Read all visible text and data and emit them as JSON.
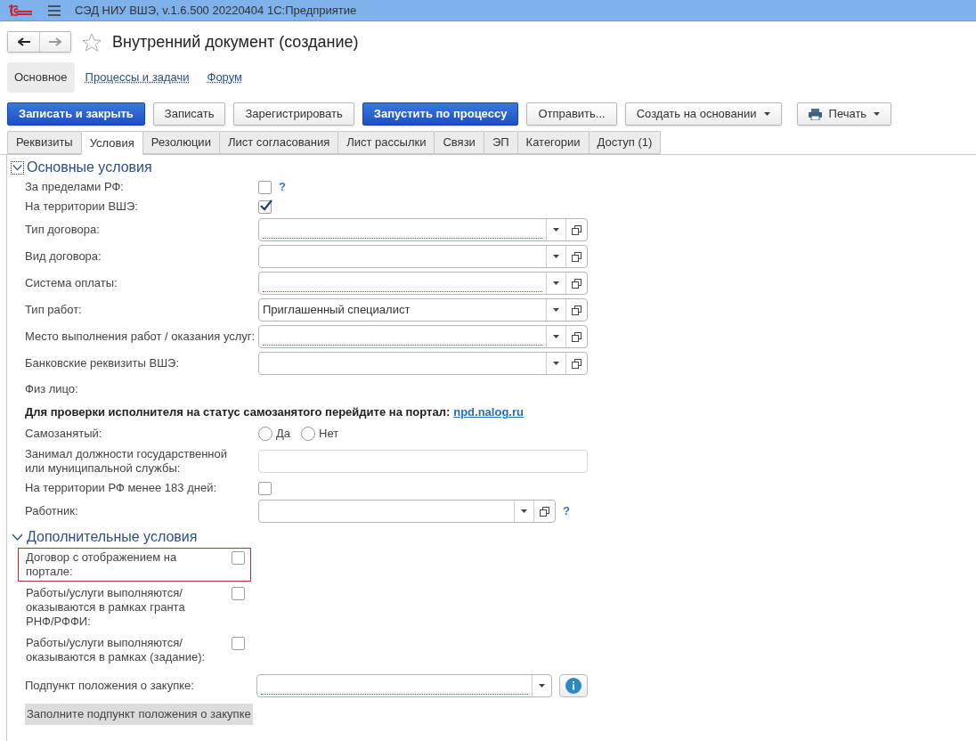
{
  "app_bar": {
    "title": "СЭД НИУ ВШЭ, v.1.6.500 20220404 1С:Предприятие"
  },
  "window": {
    "title": "Внутренний документ (создание)",
    "favorite": false
  },
  "sections": [
    {
      "label": "Основное",
      "selected": true
    },
    {
      "label": "Процессы и задачи",
      "selected": false
    },
    {
      "label": "Форум",
      "selected": false
    }
  ],
  "toolbar": [
    {
      "label": "Записать и закрыть",
      "kind": "primary"
    },
    {
      "label": "Записать",
      "kind": "plain"
    },
    {
      "label": "Зарегистрировать",
      "kind": "plain"
    },
    {
      "label": "Запустить по процессу",
      "kind": "primary"
    },
    {
      "label": "Отправить...",
      "kind": "plain"
    },
    {
      "label": "Создать на основании",
      "kind": "menu"
    },
    {
      "label": "Печать",
      "kind": "print"
    }
  ],
  "tabs": [
    {
      "label": "Реквизиты",
      "selected": false
    },
    {
      "label": "Условия",
      "selected": true
    },
    {
      "label": "Резолюции",
      "selected": false
    },
    {
      "label": "Лист согласования",
      "selected": false
    },
    {
      "label": "Лист рассылки",
      "selected": false
    },
    {
      "label": "Связи",
      "selected": false
    },
    {
      "label": "ЭП",
      "selected": false
    },
    {
      "label": "Категории",
      "selected": false
    },
    {
      "label": "Доступ (1)",
      "selected": false
    }
  ],
  "main_conditions": {
    "title": "Основные условия",
    "expanded": true,
    "fields": [
      {
        "kind": "checkbox",
        "label": "За пределами РФ:",
        "checked": false,
        "help": "?"
      },
      {
        "kind": "checkbox",
        "label": "На территории ВШЭ:",
        "checked": true
      },
      {
        "kind": "select",
        "label": "Тип договора:",
        "required": true
      },
      {
        "kind": "select",
        "label": "Вид договора:",
        "required": false
      },
      {
        "kind": "select",
        "label": "Система оплаты:",
        "required": true
      },
      {
        "kind": "select",
        "label": "Тип работ:",
        "value": "Приглашенный специалист",
        "required": false
      },
      {
        "kind": "select",
        "label": "Место выполнения работ / оказания услуг:",
        "required": true
      },
      {
        "kind": "select",
        "label": "Банковские реквизиты ВШЭ:",
        "required": false
      },
      {
        "kind": "label",
        "label": "Физ лицо:"
      },
      {
        "kind": "notice",
        "text": "Для проверки исполнителя на статус самозанятого перейдите на портал:",
        "link": "npd.nalog.ru"
      },
      {
        "kind": "radio",
        "label": "Самозанятый:",
        "options": [
          {
            "label": "Да",
            "selected": false
          },
          {
            "label": "Нет",
            "selected": false
          }
        ]
      },
      {
        "kind": "text",
        "label": "Занимал должности государственной или муниципальной службы:"
      },
      {
        "kind": "checkbox",
        "label": "На территории РФ менее 183 дней:",
        "checked": false
      },
      {
        "kind": "select",
        "label": "Работник:",
        "required": false,
        "help": "?"
      }
    ]
  },
  "extra_conditions": {
    "title": "Дополнительные условия",
    "expanded": true,
    "fields": [
      {
        "kind": "checkbox",
        "label": "Договор с отображением на портале:",
        "checked": false,
        "highlighted": true
      },
      {
        "kind": "checkbox",
        "label": "Работы/услуги выполняются/оказываются в рамках гранта РНФ/РФФИ:",
        "checked": false,
        "highlighted": false
      },
      {
        "kind": "checkbox",
        "label": "Работы/услуги выполняются/оказываются в рамках (задание):",
        "checked": false,
        "highlighted": false
      },
      {
        "kind": "select",
        "label": "Подпункт положения о закупке:",
        "required": true
      }
    ],
    "hint": "Заполните подпункт положения о закупке"
  }
}
